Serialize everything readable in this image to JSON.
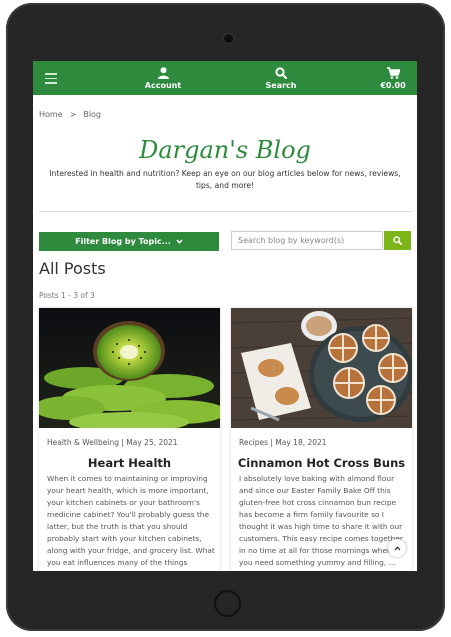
{
  "header": {
    "account_label": "Account",
    "search_label": "Search",
    "cart_label": "€0.00",
    "bg_color": "#2e8b3e"
  },
  "breadcrumb": {
    "home": "Home",
    "separator": ">",
    "current": "Blog"
  },
  "blog": {
    "title": "Dargan's Blog",
    "intro": "Interested in health and nutrition? Keep an eye on our blog articles below for news, reviews, tips, and more!"
  },
  "filter": {
    "label": "Filter Blog by Topic..."
  },
  "search": {
    "placeholder": "Search blog by keyword(s)"
  },
  "listing": {
    "heading": "All Posts",
    "count": "Posts 1 - 3 of 3"
  },
  "posts": [
    {
      "category": "Health & Wellbeing",
      "date": "May 25, 2021",
      "title": "Heart Health",
      "excerpt": "When it comes to maintaining or improving your heart health, which is more important, your kitchen cabinets or your bathroom's medicine cabinet? You'll probably guess the latter, but the truth is that you should probably start with your kitchen cabinets, along with your fridge, and grocery list. What you eat influences many of the things"
    },
    {
      "category": "Recipes",
      "date": "May 18, 2021",
      "title": "Cinnamon Hot Cross Buns",
      "excerpt": "I absolutely love baking with almond flour and since our Easter Family Bake Off this gluten-free hot cross cinnamon bun recipe has become a firm family favourite so I thought it was high time to share it with our customers. This easy recipe comes together in no time at all for those mornings when you need something yummy and filling, ..."
    }
  ],
  "icons": {
    "menu": "hamburger-menu-icon",
    "account": "user-icon",
    "search": "search-icon",
    "cart": "cart-icon",
    "chevron": "chevron-down-icon",
    "scroll_top": "chevron-up-icon"
  },
  "colors": {
    "brand_green": "#2e8b3e",
    "search_button": "#7cb518"
  }
}
